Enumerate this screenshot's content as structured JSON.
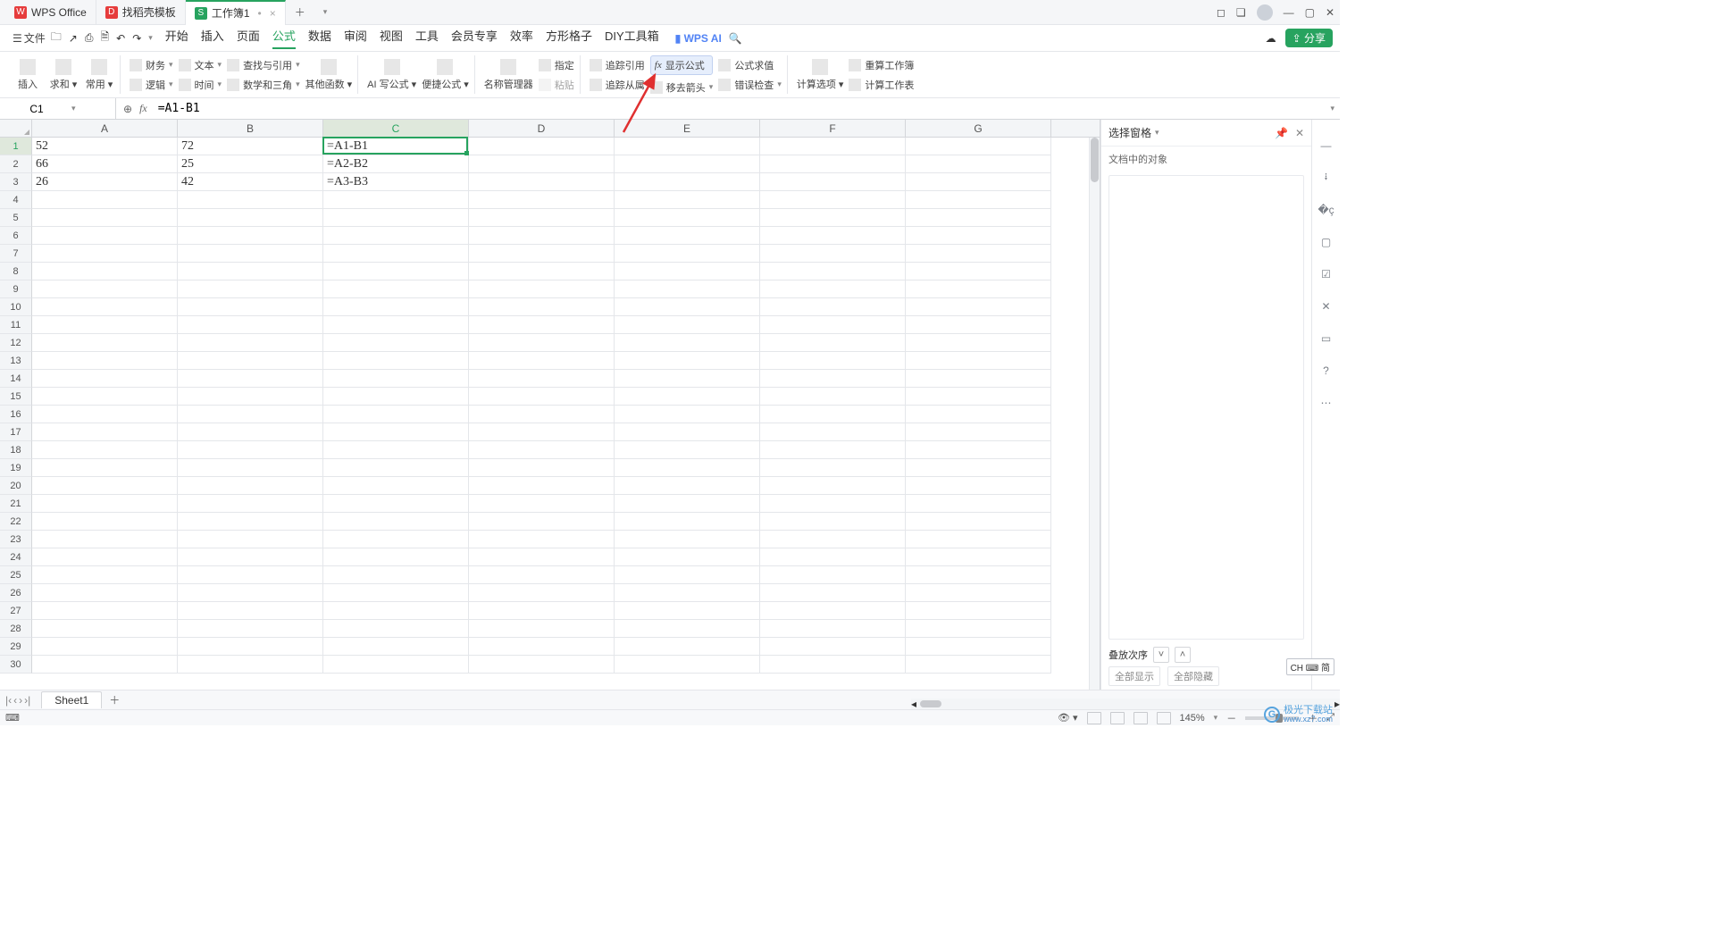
{
  "tabs": {
    "app1": "WPS Office",
    "app2": "找稻壳模板",
    "app3": "工作簿1"
  },
  "menu": {
    "file": "文件",
    "items": [
      "开始",
      "插入",
      "页面",
      "公式",
      "数据",
      "审阅",
      "视图",
      "工具",
      "会员专享",
      "效率",
      "方形格子",
      "DIY工具箱"
    ],
    "active_index": 3,
    "wpsai": "WPS AI",
    "share": "分享"
  },
  "ribbon": {
    "g1": {
      "insert": "插入",
      "sum": "求和",
      "common": "常用"
    },
    "g2": {
      "finance": "财务",
      "text": "文本",
      "lookup": "查找与引用",
      "logic": "逻辑",
      "time": "时间",
      "math": "数学和三角",
      "other": "其他函数"
    },
    "g3": {
      "aiwrite": "AI 写公式",
      "quick": "便捷公式"
    },
    "g4": {
      "name_mgr": "名称管理器",
      "assign": "指定",
      "paste": "粘贴"
    },
    "g5": {
      "trace_ref": "追踪引用",
      "trace_dep": "追踪从属",
      "show_formula": "显示公式",
      "remove_arrow": "移去箭头",
      "eval": "公式求值",
      "err_check": "错误检查"
    },
    "g6": {
      "calc_opt": "计算选项",
      "recalc": "重算工作簿",
      "calc_sheet": "计算工作表"
    }
  },
  "namebox": "C1",
  "formula": "=A1-B1",
  "cols": [
    "A",
    "B",
    "C",
    "D",
    "E",
    "F",
    "G"
  ],
  "rows": 30,
  "cells": {
    "A1": "52",
    "B1": "72",
    "C1": "=A1-B1",
    "A2": "66",
    "B2": "25",
    "C2": "=A2-B2",
    "A3": "26",
    "B3": "42",
    "C3": "=A3-B3"
  },
  "selection": {
    "col": 2,
    "row": 0
  },
  "right_pane": {
    "title": "选择窗格",
    "sub": "文档中的对象",
    "stack": "叠放次序",
    "show_all": "全部显示",
    "hide_all": "全部隐藏"
  },
  "sheet": {
    "name": "Sheet1"
  },
  "status": {
    "zoom": "145%",
    "ime": "CH ⌨ 简",
    "sb_icon": "⌨"
  },
  "watermark": {
    "brand": "极光下载站",
    "url": "www.xz7.com"
  }
}
